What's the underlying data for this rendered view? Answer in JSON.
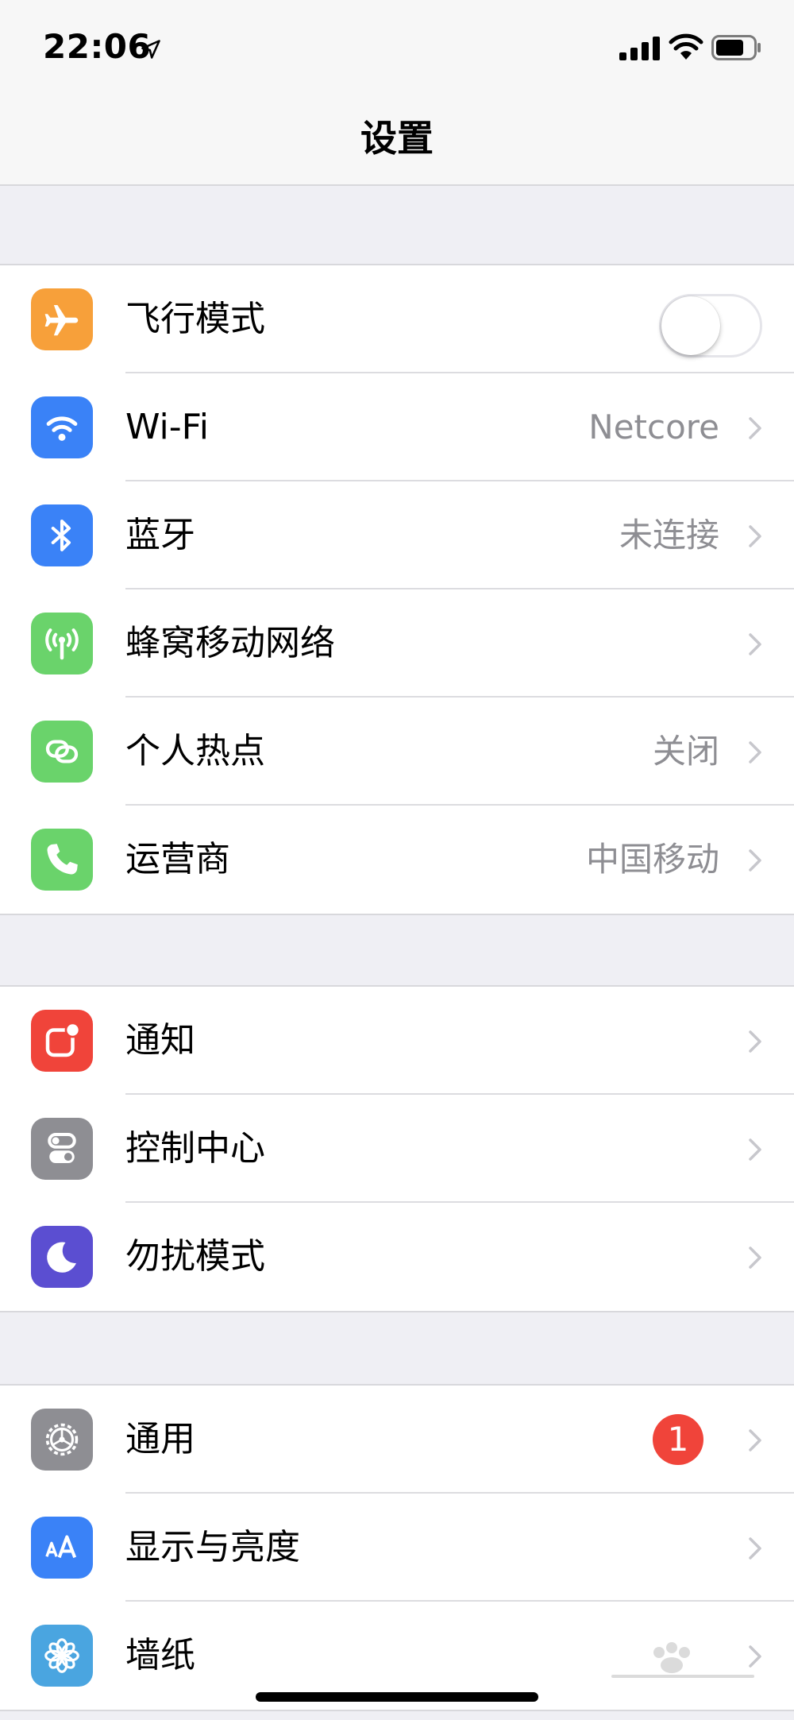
{
  "status_bar": {
    "time": "22:06",
    "location_icon": "location-arrow-icon",
    "signal_icon": "cellular-signal-icon",
    "wifi_icon": "wifi-icon",
    "battery_icon": "battery-icon"
  },
  "nav": {
    "title": "设置"
  },
  "groups": [
    {
      "rows": [
        {
          "label": "飞行模式",
          "icon": "airplane-icon",
          "icon_color": "#f7a03a",
          "control": "toggle",
          "toggle_on": false
        },
        {
          "label": "Wi-Fi",
          "icon": "wifi-icon",
          "icon_color": "#3a82f7",
          "value": "Netcore"
        },
        {
          "label": "蓝牙",
          "icon": "bluetooth-icon",
          "icon_color": "#3a82f7",
          "value": "未连接"
        },
        {
          "label": "蜂窝移动网络",
          "icon": "antenna-icon",
          "icon_color": "#6ad36b",
          "value": ""
        },
        {
          "label": "个人热点",
          "icon": "hotspot-link-icon",
          "icon_color": "#6ad36b",
          "value": "关闭"
        },
        {
          "label": "运营商",
          "icon": "phone-icon",
          "icon_color": "#6ad36b",
          "value": "中国移动"
        }
      ]
    },
    {
      "rows": [
        {
          "label": "通知",
          "icon": "notification-icon",
          "icon_color": "#f0443a",
          "value": ""
        },
        {
          "label": "控制中心",
          "icon": "control-center-icon",
          "icon_color": "#8e8e93",
          "value": ""
        },
        {
          "label": "勿扰模式",
          "icon": "moon-icon",
          "icon_color": "#5b4ed1",
          "value": ""
        }
      ]
    },
    {
      "rows": [
        {
          "label": "通用",
          "icon": "gear-icon",
          "icon_color": "#8e8e93",
          "badge": "1"
        },
        {
          "label": "显示与亮度",
          "icon": "text-size-icon",
          "icon_color": "#3a82f7",
          "value": ""
        },
        {
          "label": "墙纸",
          "icon": "flower-icon",
          "icon_color": "#4aa5e0",
          "value": ""
        }
      ]
    }
  ],
  "colors": {
    "background": "#efeff4",
    "separator": "#dcdce0",
    "secondary_text": "#8e8e93",
    "badge": "#f0443a"
  }
}
